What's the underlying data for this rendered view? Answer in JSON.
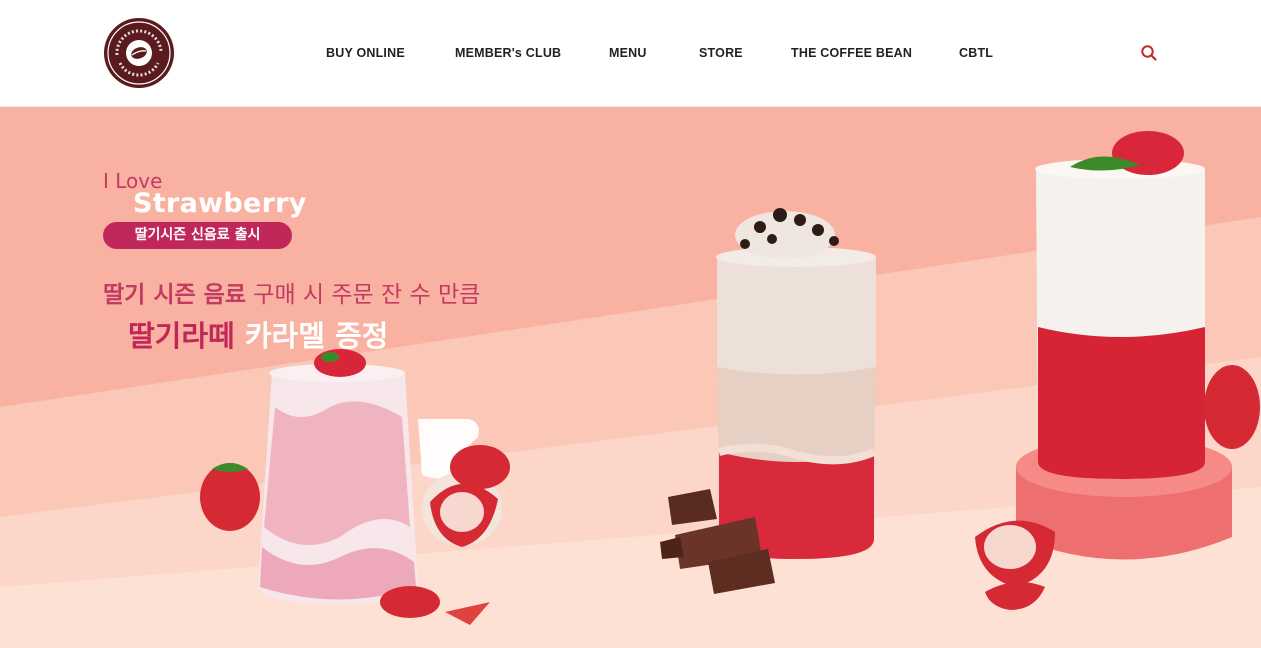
{
  "brand": {
    "logo_text_top": "The Coffee Bean",
    "logo_text_bottom": "& Tea Leaf",
    "colors": {
      "brand": "#5a1a1e",
      "accent": "#c0285a",
      "search": "#c0282d"
    }
  },
  "nav": {
    "items": [
      "BUY ONLINE",
      "MEMBER's CLUB",
      "MENU",
      "STORE",
      "THE COFFEE BEAN",
      "CBTL"
    ],
    "search_icon": "search-icon"
  },
  "hero": {
    "line_love": "I Love",
    "line_strawberry": "Strawberry",
    "pill": "딸기시즌 신음료 출시",
    "promo_bold": "딸기 시즌 음료",
    "promo_rest": " 구매 시 주문 잔 수 만큼",
    "gift_pink": "딸기라떼",
    "gift_white": " 카라멜 증정",
    "colors": {
      "bg": "#f9b2a1",
      "pink_text": "#c33a62",
      "pill_bg": "#c0285a"
    }
  }
}
